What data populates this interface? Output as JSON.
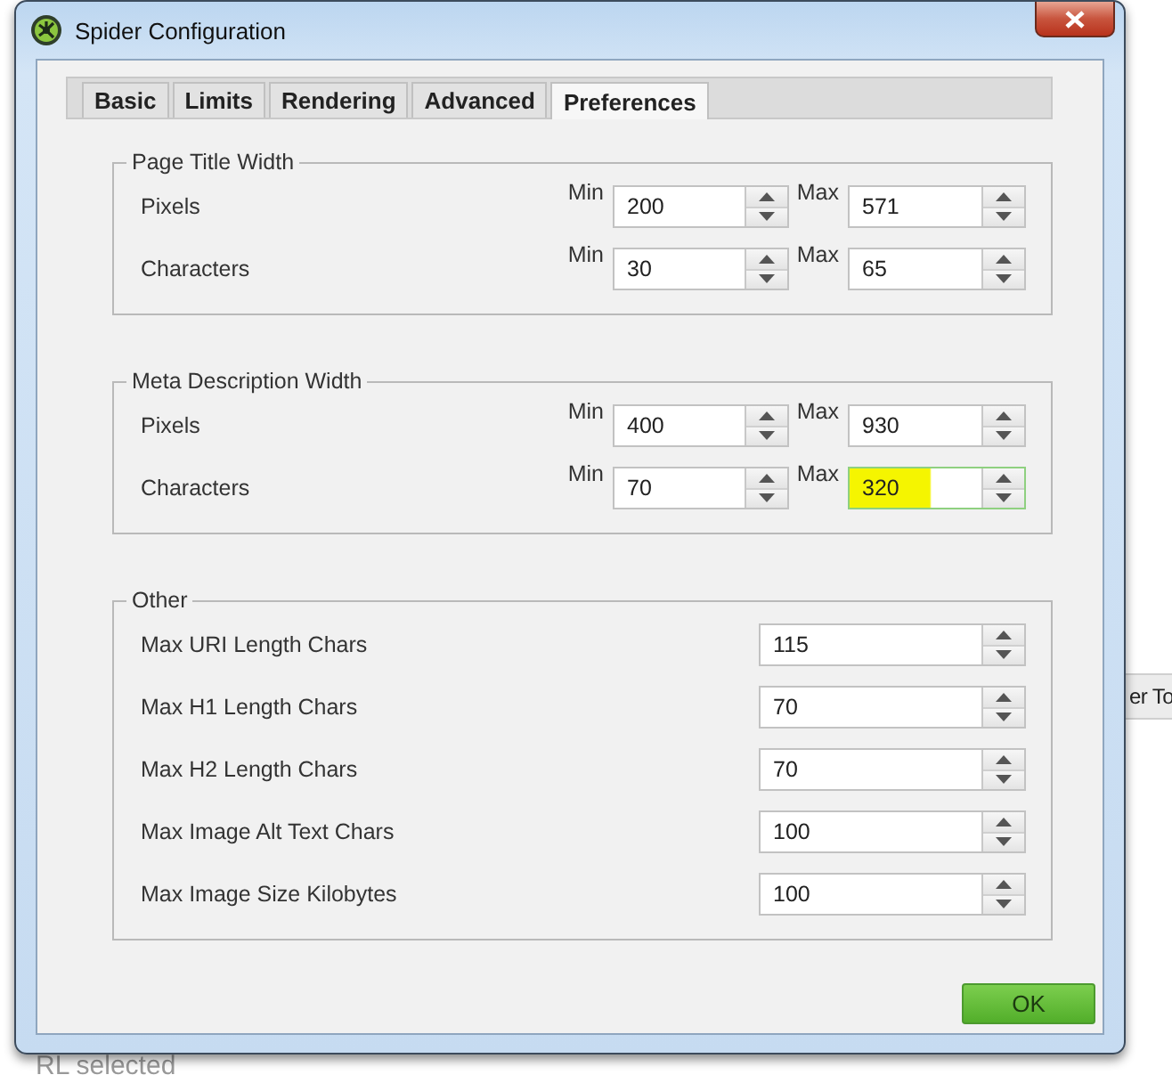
{
  "background": {
    "texts": [
      "er To",
      "RL selected"
    ]
  },
  "window": {
    "title": "Spider Configuration"
  },
  "tabs": [
    {
      "label": "Basic",
      "selected": false
    },
    {
      "label": "Limits",
      "selected": false
    },
    {
      "label": "Rendering",
      "selected": false
    },
    {
      "label": "Advanced",
      "selected": false
    },
    {
      "label": "Preferences",
      "selected": true
    }
  ],
  "groups": [
    {
      "title": "Page Title Width",
      "kind": "range",
      "rows": [
        {
          "label": "Pixels",
          "min": {
            "label": "Min",
            "value": "200",
            "highlighted": false
          },
          "max": {
            "label": "Max",
            "value": "571",
            "highlighted": false
          }
        },
        {
          "label": "Characters",
          "min": {
            "label": "Min",
            "value": "30",
            "highlighted": false
          },
          "max": {
            "label": "Max",
            "value": "65",
            "highlighted": false
          }
        }
      ]
    },
    {
      "title": "Meta Description Width",
      "kind": "range",
      "rows": [
        {
          "label": "Pixels",
          "min": {
            "label": "Min",
            "value": "400",
            "highlighted": false
          },
          "max": {
            "label": "Max",
            "value": "930",
            "highlighted": false
          }
        },
        {
          "label": "Characters",
          "min": {
            "label": "Min",
            "value": "70",
            "highlighted": false
          },
          "max": {
            "label": "Max",
            "value": "320",
            "highlighted": true
          }
        }
      ]
    },
    {
      "title": "Other",
      "kind": "single",
      "rows": [
        {
          "label": "Max URI Length Chars",
          "field": {
            "value": "115",
            "highlighted": false
          }
        },
        {
          "label": "Max H1 Length Chars",
          "field": {
            "value": "70",
            "highlighted": false
          }
        },
        {
          "label": "Max H2 Length Chars",
          "field": {
            "value": "70",
            "highlighted": false
          }
        },
        {
          "label": "Max Image Alt Text Chars",
          "field": {
            "value": "100",
            "highlighted": false
          }
        },
        {
          "label": "Max Image Size Kilobytes",
          "field": {
            "value": "100",
            "highlighted": false
          }
        }
      ]
    }
  ],
  "buttons": [
    {
      "label": "OK"
    }
  ]
}
